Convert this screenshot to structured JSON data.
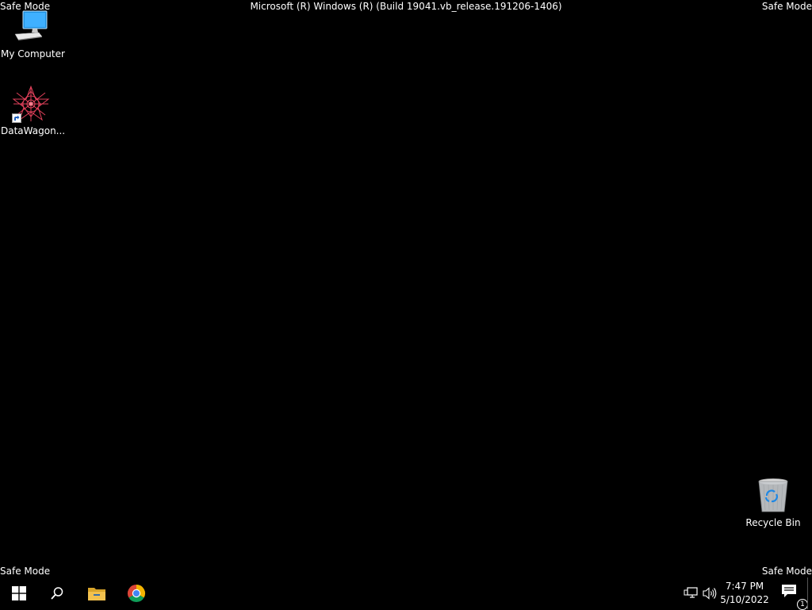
{
  "desktop": {
    "safe_mode_label": "Safe Mode",
    "build_info": "Microsoft (R) Windows (R) (Build 19041.vb_release.191206-1406)",
    "background_color": "#000000",
    "icons": [
      {
        "label": "My Computer",
        "icon": "computer-icon"
      },
      {
        "label": "DataWagon...",
        "icon": "datawagon-app-icon",
        "shortcut": true
      },
      {
        "label": "Recycle Bin",
        "icon": "recycle-bin-icon"
      }
    ]
  },
  "taskbar": {
    "pinned": [
      {
        "name": "Start",
        "icon": "windows-logo-icon"
      },
      {
        "name": "Search",
        "icon": "search-icon"
      },
      {
        "name": "File Explorer",
        "icon": "folder-icon"
      },
      {
        "name": "Google Chrome",
        "icon": "chrome-icon"
      }
    ],
    "tray": {
      "network_icon": "network-icon",
      "volume_icon": "volume-icon",
      "time": "7:47 PM",
      "date": "5/10/2022",
      "notification_count": "1"
    },
    "accent_colors": {
      "windows_logo": "#ffffff",
      "folder": "#f2c14e",
      "chrome_red": "#db4437",
      "chrome_green": "#0f9d58",
      "chrome_yellow": "#f4b400",
      "chrome_blue": "#4285f4"
    }
  }
}
